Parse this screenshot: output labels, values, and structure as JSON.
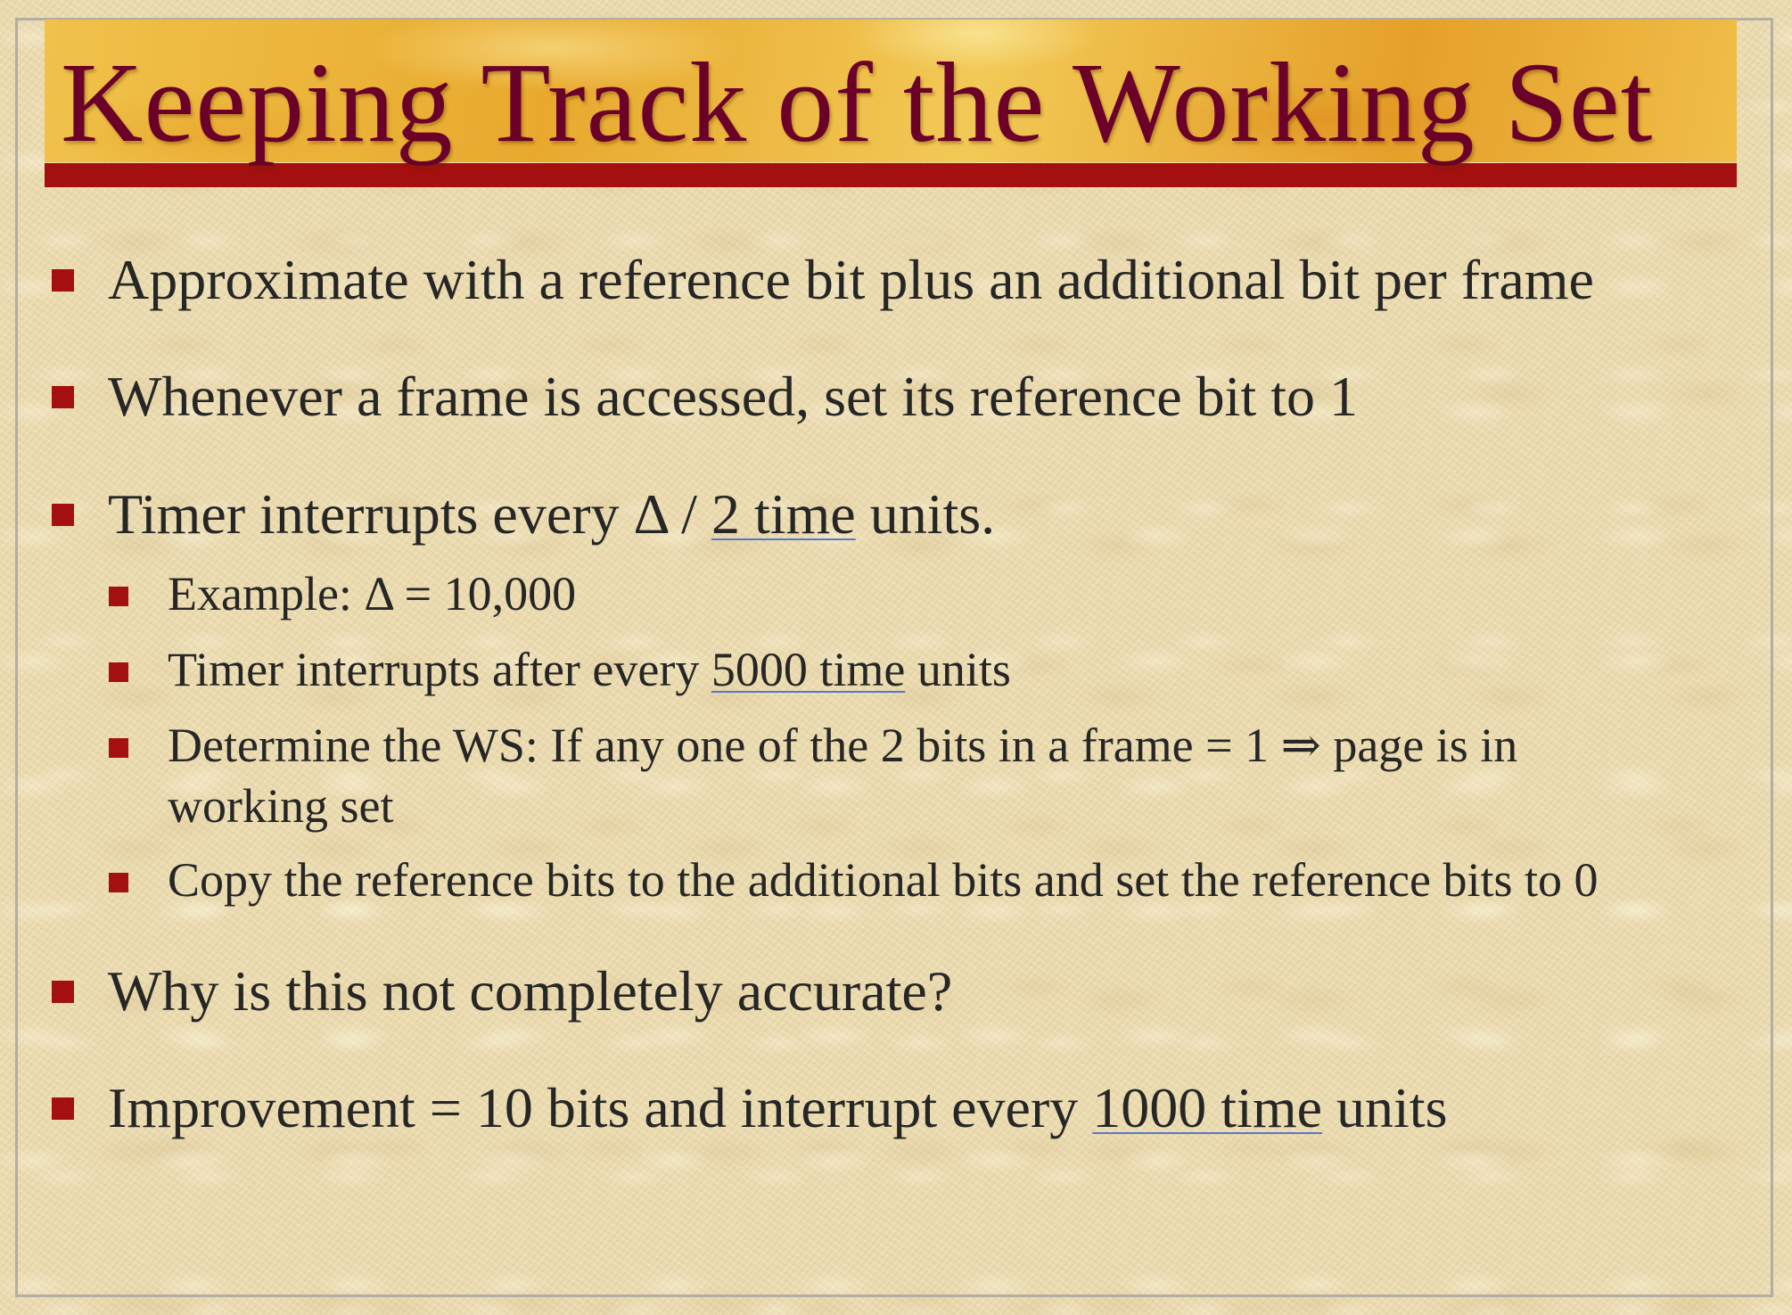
{
  "slide": {
    "title": "Keeping Track of the Working Set",
    "bullets": {
      "b1": {
        "text": "Approximate with a reference bit plus an additional bit per frame"
      },
      "b2": {
        "text": "Whenever a frame is accessed, set its reference bit to 1"
      },
      "b3": {
        "before": "Timer interrupts every Δ / ",
        "underlined": "2 time",
        "after": " units."
      },
      "b3_sub": {
        "s1": {
          "text": "Example: Δ = 10,000"
        },
        "s2": {
          "before": "Timer interrupts after every ",
          "underlined": "5000 time",
          "after": " units"
        },
        "s3": {
          "line1": "Determine the WS: If any one of the 2 bits in a frame = 1 ⇒ page is in",
          "line2": "working set"
        },
        "s4": {
          "text": "Copy the reference bits to the additional bits and set the reference bits to 0"
        }
      },
      "b4": {
        "text": "Why is this not completely accurate?"
      },
      "b5": {
        "before": "Improvement = 10 bits and interrupt every ",
        "underlined": "1000 time",
        "after": " units"
      }
    }
  },
  "colors": {
    "title_text": "#6b0028",
    "banner_gold": "#f0c24a",
    "title_rule": "#a3100f",
    "bullet": "#a3100f",
    "body_text": "#262626",
    "background": "#ecdcb0",
    "underline": "#5a78c8"
  }
}
